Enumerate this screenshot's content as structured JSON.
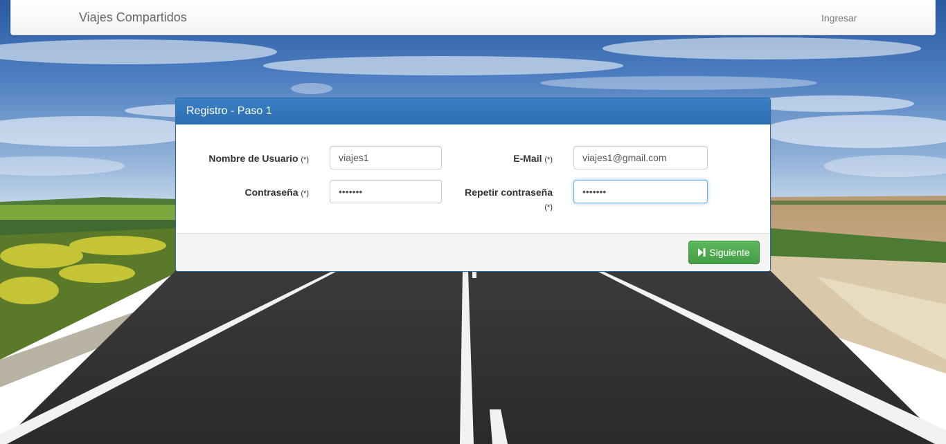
{
  "navbar": {
    "brand": "Viajes Compartidos",
    "login_link": "Ingresar"
  },
  "panel": {
    "title": "Registro - Paso 1",
    "required_marker": "(*)",
    "fields": {
      "username": {
        "label": "Nombre de Usuario",
        "value": "viajes1"
      },
      "email": {
        "label": "E-Mail",
        "value": "viajes1@gmail.com"
      },
      "password": {
        "label": "Contraseña",
        "value": "•••••••"
      },
      "repeat_password": {
        "label": "Repetir contraseña",
        "value": "•••••••"
      }
    },
    "next_button": {
      "label": "Siguiente",
      "icon": "step-forward-icon"
    }
  },
  "colors": {
    "panel_header": "#337ab7",
    "button_success": "#5cb85c",
    "focus_border": "#66afe9"
  }
}
